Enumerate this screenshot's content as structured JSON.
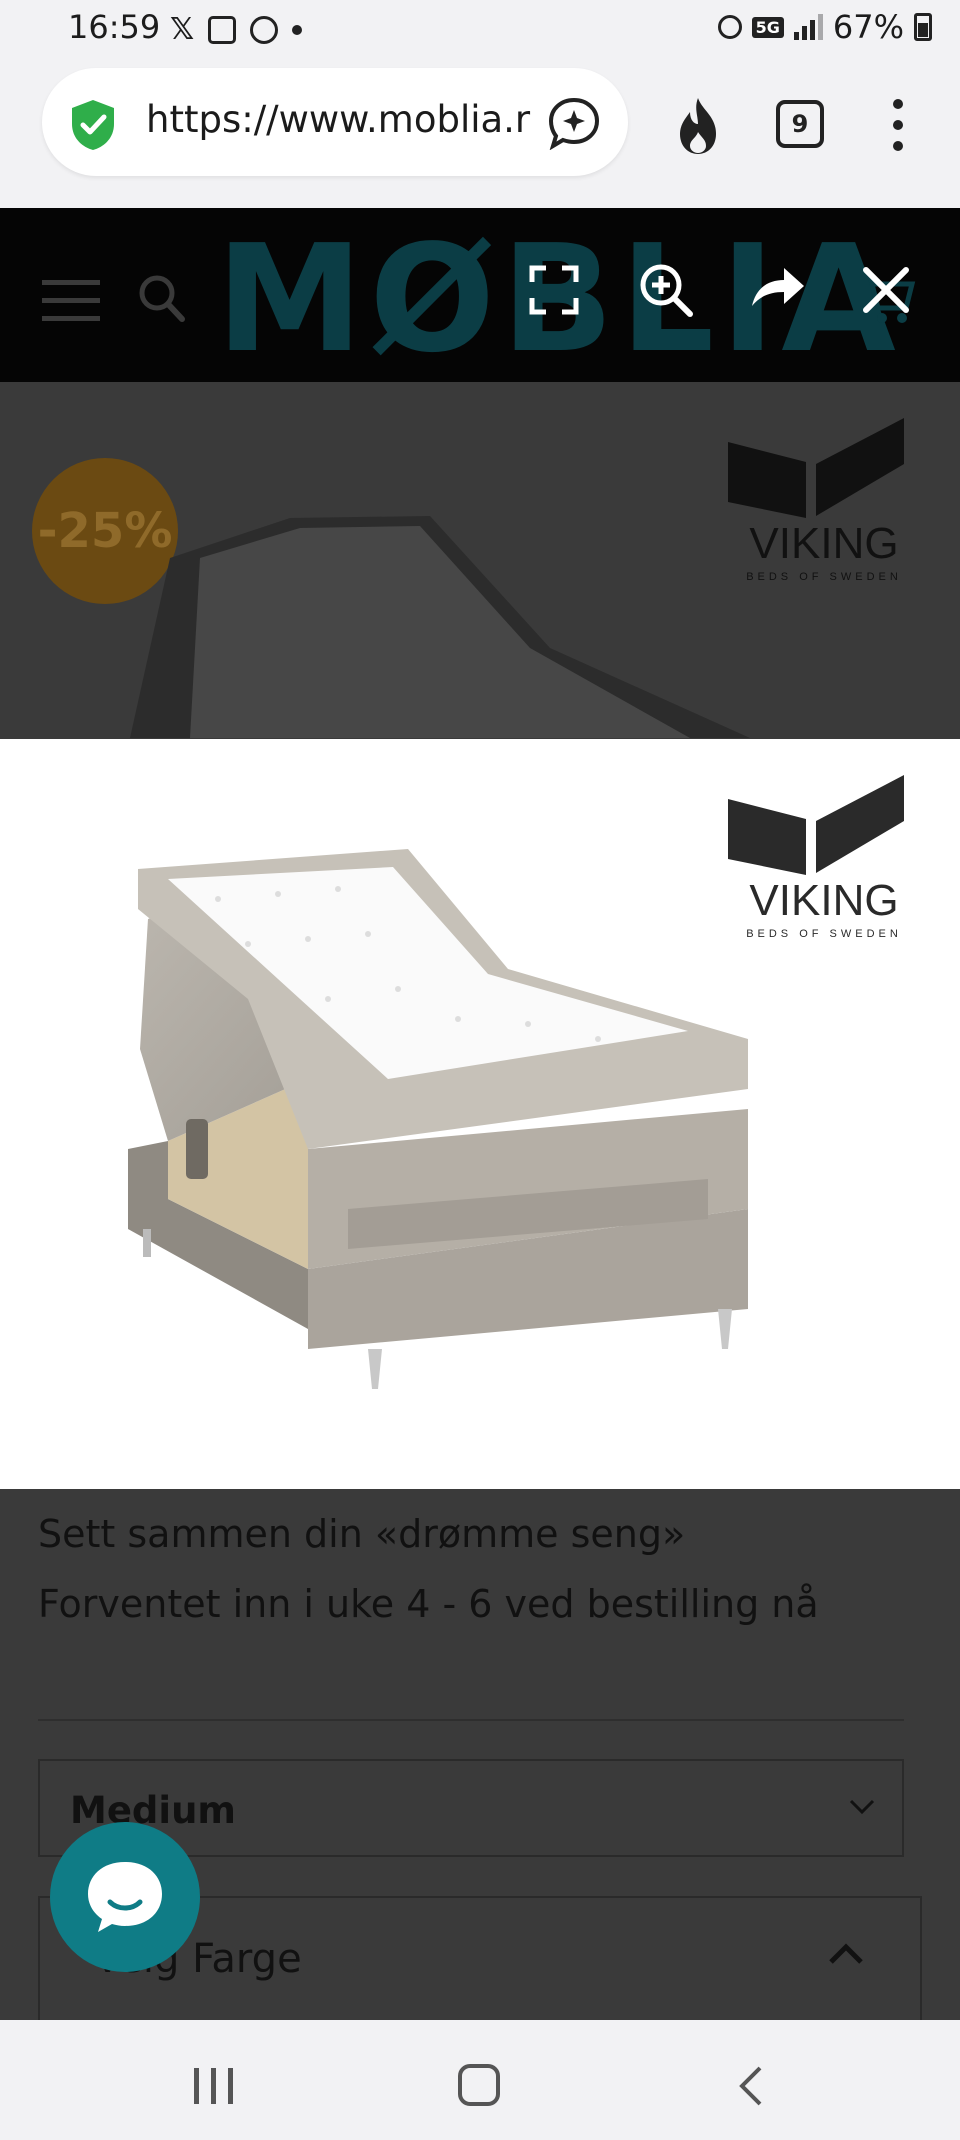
{
  "status_bar": {
    "time": "16:59",
    "network": "5G",
    "battery": "67%"
  },
  "browser": {
    "url": "https://www.moblia.r",
    "tab_count": "9"
  },
  "site": {
    "logo_text": "MØBLIA",
    "discount_badge": "-25%",
    "brand_name": "VIKING",
    "brand_tagline": "BEDS OF SWEDEN"
  },
  "product": {
    "description_line1": "Sett sammen din «drømme seng»",
    "description_line2": "Forventet inn i uke 4 - 6 ved bestilling nå",
    "firmness_selected": "Medium",
    "color_label": "Velg Farge"
  }
}
